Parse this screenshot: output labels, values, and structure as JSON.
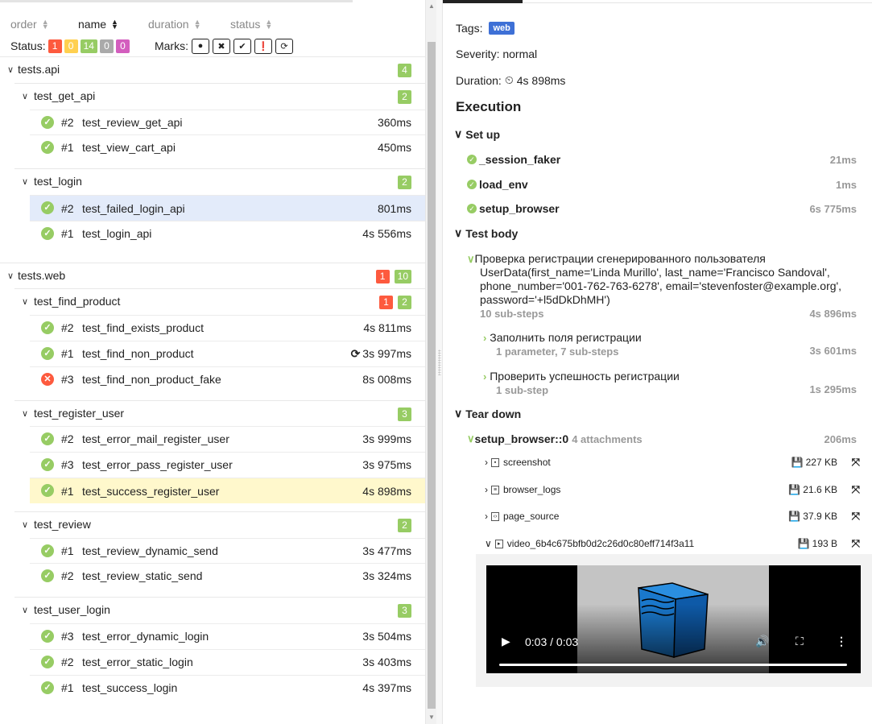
{
  "sort": [
    {
      "label": "order",
      "active": false
    },
    {
      "label": "name",
      "active": true
    },
    {
      "label": "duration",
      "active": false
    },
    {
      "label": "status",
      "active": false
    }
  ],
  "status_bar": {
    "label": "Status:",
    "counts": [
      {
        "value": "1",
        "color": "#fd5a3e"
      },
      {
        "value": "0",
        "color": "#ffd050"
      },
      {
        "value": "14",
        "color": "#97cc64"
      },
      {
        "value": "0",
        "color": "#aaaaaa"
      },
      {
        "value": "0",
        "color": "#d35ebe"
      }
    ],
    "marks_label": "Marks:",
    "marks": [
      "bomb-icon",
      "x-circle-icon",
      "check-circle-icon",
      "exclamation-circle-icon",
      "refresh-icon"
    ]
  },
  "tree": {
    "api": {
      "name": "tests.api",
      "count": "4",
      "get_api": {
        "name": "test_get_api",
        "count": "2",
        "rows": [
          {
            "num": "#2",
            "name": "test_review_get_api",
            "duration": "360ms"
          },
          {
            "num": "#1",
            "name": "test_view_cart_api",
            "duration": "450ms"
          }
        ]
      },
      "login": {
        "name": "test_login",
        "count": "2",
        "rows": [
          {
            "num": "#2",
            "name": "test_failed_login_api",
            "duration": "801ms"
          },
          {
            "num": "#1",
            "name": "test_login_api",
            "duration": "4s 556ms"
          }
        ]
      }
    },
    "web": {
      "name": "tests.web",
      "failed": "1",
      "passed": "10",
      "find_product": {
        "name": "test_find_product",
        "failed": "1",
        "passed": "2",
        "rows": [
          {
            "num": "#2",
            "name": "test_find_exists_product",
            "duration": "4s 811ms"
          },
          {
            "num": "#1",
            "name": "test_find_non_product",
            "duration": "3s 997ms"
          },
          {
            "num": "#3",
            "name": "test_find_non_product_fake",
            "duration": "8s 008ms"
          }
        ]
      },
      "register_user": {
        "name": "test_register_user",
        "count": "3",
        "rows": [
          {
            "num": "#2",
            "name": "test_error_mail_register_user",
            "duration": "3s 999ms"
          },
          {
            "num": "#3",
            "name": "test_error_pass_register_user",
            "duration": "3s 975ms"
          },
          {
            "num": "#1",
            "name": "test_success_register_user",
            "duration": "4s 898ms"
          }
        ]
      },
      "review": {
        "name": "test_review",
        "count": "2",
        "rows": [
          {
            "num": "#1",
            "name": "test_review_dynamic_send",
            "duration": "3s 477ms"
          },
          {
            "num": "#2",
            "name": "test_review_static_send",
            "duration": "3s 324ms"
          }
        ]
      },
      "user_login": {
        "name": "test_user_login",
        "count": "3",
        "rows": [
          {
            "num": "#3",
            "name": "test_error_dynamic_login",
            "duration": "3s 504ms"
          },
          {
            "num": "#2",
            "name": "test_error_static_login",
            "duration": "3s 403ms"
          },
          {
            "num": "#1",
            "name": "test_success_login",
            "duration": "4s 397ms"
          }
        ]
      }
    }
  },
  "details": {
    "tags_label": "Tags:",
    "tag": "web",
    "severity": "Severity: normal",
    "duration_label": "Duration:",
    "duration": "4s 898ms",
    "execution": "Execution",
    "setup": {
      "title": "Set up",
      "steps": [
        {
          "name": "_session_faker",
          "duration": "21ms"
        },
        {
          "name": "load_env",
          "duration": "1ms"
        },
        {
          "name": "setup_browser",
          "duration": "6s 775ms"
        }
      ]
    },
    "body": {
      "title": "Test body",
      "step_line1": "Проверка регистрации сгенерированного пользователя",
      "step_line2": "UserData(first_name='Linda Murillo', last_name='Francisco Sandoval',",
      "step_line3": "phone_number='001-762-763-6278', email='stevenfoster@example.org',",
      "step_line4": "password='+l5dDkDhMH')",
      "step_sub": "10 sub-steps",
      "step_duration": "4s 896ms",
      "sub1": {
        "name": "Заполнить поля регистрации",
        "meta": "1 parameter, 7 sub-steps",
        "duration": "3s 601ms"
      },
      "sub2": {
        "name": "Проверить успешность регистрации",
        "meta": "1 sub-step",
        "duration": "1s 295ms"
      }
    },
    "teardown": {
      "title": "Tear down",
      "step": "setup_browser::0",
      "attachments_count": "4 attachments",
      "duration": "206ms",
      "attachments": [
        {
          "name": "screenshot",
          "size": "227 KB",
          "icon": "image-file-icon"
        },
        {
          "name": "browser_logs",
          "size": "21.6 KB",
          "icon": "text-file-icon"
        },
        {
          "name": "page_source",
          "size": "37.9 KB",
          "icon": "code-file-icon"
        },
        {
          "name": "video_6b4c675bfb0d2c26d0c80eff714f3a11",
          "size": "193 B",
          "icon": "video-file-icon"
        }
      ]
    },
    "video": {
      "time": "0:03 / 0:03"
    }
  }
}
